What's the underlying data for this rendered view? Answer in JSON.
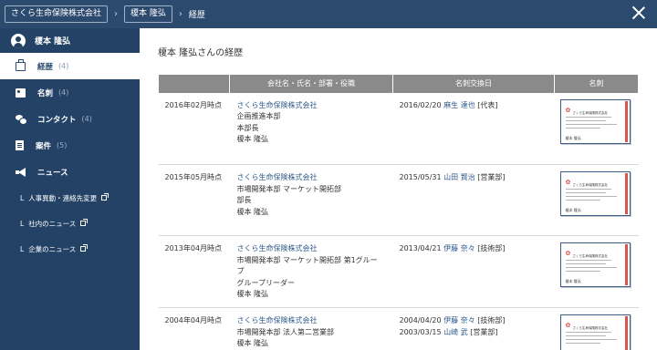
{
  "breadcrumb": {
    "company": "さくら生命保険株式会社",
    "person": "榎本 隆弘",
    "current": "経歴"
  },
  "user": {
    "name": "榎本 隆弘"
  },
  "nav": [
    {
      "label": "経歴",
      "count": "(4)",
      "icon": "briefcase-icon",
      "active": true
    },
    {
      "label": "名刺",
      "count": "(4)",
      "icon": "business-card-icon"
    },
    {
      "label": "コンタクト",
      "count": "(4)",
      "icon": "chat-icon"
    },
    {
      "label": "案件",
      "count": "(5)",
      "icon": "document-icon"
    },
    {
      "label": "ニュース",
      "count": "",
      "icon": "megaphone-icon"
    }
  ],
  "news_links": [
    {
      "label": "人事異動・連絡先変更",
      "dash": "L"
    },
    {
      "label": "社内のニュース",
      "dash": "L"
    },
    {
      "label": "企業のニュース",
      "dash": "L"
    }
  ],
  "page_title": "榎本 隆弘さんの経歴",
  "table": {
    "headers": [
      "",
      "会社名・氏名・部署・役職",
      "名刺交換日",
      "名刺"
    ],
    "rows": [
      {
        "date": "2016年02月時点",
        "company": "さくら生命保険株式会社",
        "dept": [
          "企画推進本部",
          "本部長",
          "榎本 隆弘"
        ],
        "exchanges": [
          {
            "date": "2016/02/20",
            "person": "麻生 達也",
            "tag": "[代表]"
          }
        ]
      },
      {
        "date": "2015年05月時点",
        "company": "さくら生命保険株式会社",
        "dept": [
          "市場開発本部 マーケット開拓部",
          "部長",
          "榎本 隆弘"
        ],
        "exchanges": [
          {
            "date": "2015/05/31",
            "person": "山田 賢治",
            "tag": "[営業部]"
          }
        ]
      },
      {
        "date": "2013年04月時点",
        "company": "さくら生命保険株式会社",
        "dept": [
          "市場開発本部 マーケット開拓部 第1グルー",
          "プ",
          "グループリーダー",
          "榎本 隆弘"
        ],
        "exchanges": [
          {
            "date": "2013/04/21",
            "person": "伊藤 奈々",
            "tag": "[技術部]"
          }
        ]
      },
      {
        "date": "2004年04月時点",
        "company": "さくら生命保険株式会社",
        "dept": [
          "市場開発本部 法人第二営業部",
          "榎本 隆弘"
        ],
        "exchanges": [
          {
            "date": "2004/04/20",
            "person": "伊藤 奈々",
            "tag": "[技術部]"
          },
          {
            "date": "2003/03/15",
            "person": "山崎 武",
            "tag": "[営業部]"
          }
        ]
      }
    ]
  },
  "card": {
    "company": "さくら生命保険株式会社",
    "name": "榎本 隆弘",
    "logo": "✿"
  },
  "colors": {
    "topbar": "#2c4a6e",
    "sidebar": "#234266",
    "header": "#8a8a8a",
    "link": "#2e5a8a",
    "card_accent": "#d9534f"
  }
}
